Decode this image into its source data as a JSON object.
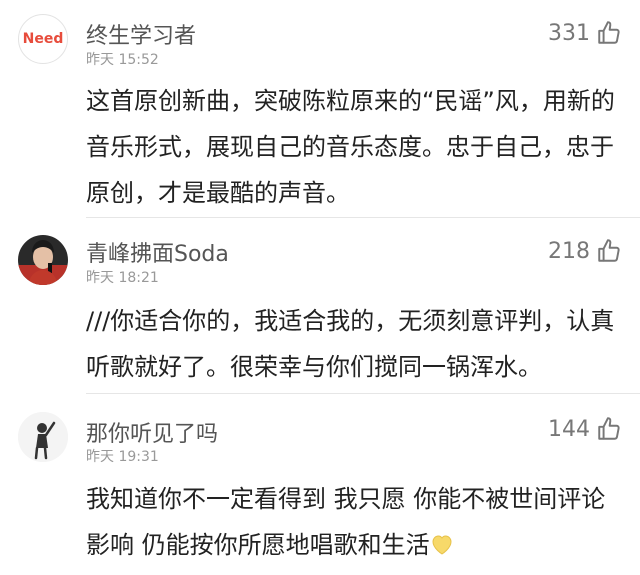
{
  "comments": [
    {
      "username": "终生学习者",
      "time": "昨天 15:52",
      "likes": "331",
      "avatar_text": "Need",
      "lines": [
        "这首原创新曲，突破陈粒原来的“民谣”风，用新的",
        "音乐形式，展现自己的音乐态度。忠于自己，忠于",
        "原创，才是最酷的声音。"
      ]
    },
    {
      "username": "青峰拂面Soda",
      "time": "昨天 18:21",
      "likes": "218",
      "lines": [
        "///你适合你的，我适合我的，无须刻意评判，认真",
        "听歌就好了。很荣幸与你们搅同一锅浑水。"
      ]
    },
    {
      "username": "那你听见了吗",
      "time": "昨天 19:31",
      "likes": "144",
      "lines": [
        "我知道你不一定看得到 我只愿 你能不被世间评论",
        "影响 仍能按你所愿地唱歌和生活"
      ],
      "emoji": "yellow-heart-emoji"
    }
  ],
  "colors": {
    "username": "#555555",
    "time": "#999999",
    "text": "#222222",
    "divider": "#e6e6e6",
    "avatar_badge_text": "#e74c3c",
    "heart": "#f7d96a"
  },
  "icons": [
    "thumbs-up-icon"
  ]
}
